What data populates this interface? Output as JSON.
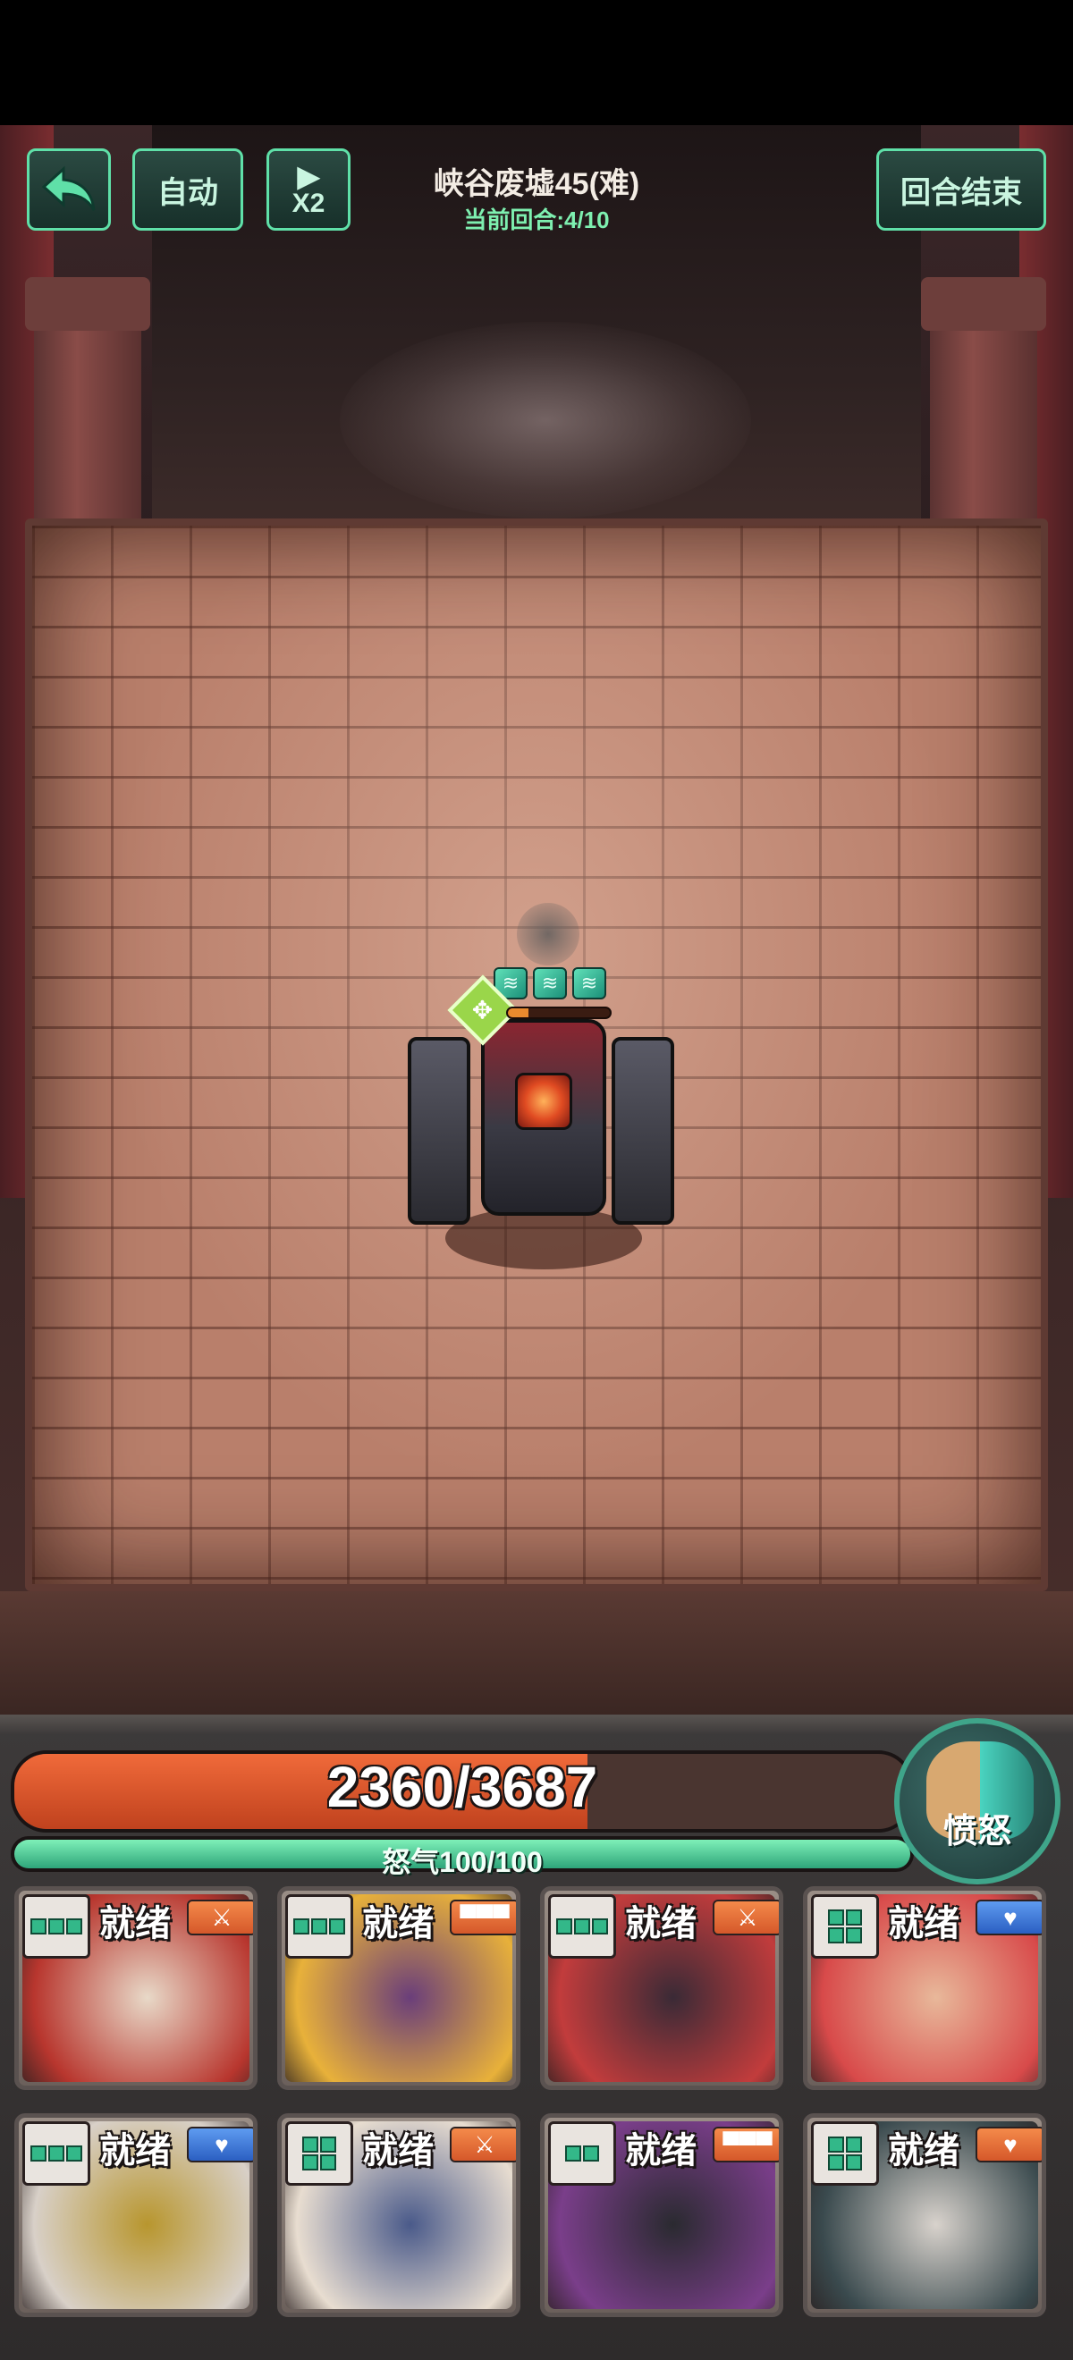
{
  "hud": {
    "back_icon": "back-arrow-icon",
    "auto_label": "自动",
    "speed_play_glyph": "▶",
    "speed_label": "X2",
    "end_turn_label": "回合结束",
    "stage_title": "峡谷废墟45(难)",
    "turn_info": "当前回合:4/10"
  },
  "enemy": {
    "name_icon": "mech-boss",
    "status_icons": [
      "wind-buff-icon",
      "wind-buff-icon",
      "wind-buff-icon"
    ],
    "status_glyph": "≋",
    "target_glyph": "✥",
    "hp_fraction": 0.2
  },
  "team": {
    "hp_text": "2360/3687",
    "hp_current": 2360,
    "hp_max": 3687,
    "rage_text": "怒气100/100",
    "rage_current": 100,
    "rage_max": 100,
    "fury_label": "愤怒"
  },
  "colors": {
    "accent_green": "#5fe0a8",
    "hp_orange": "#f06a3a",
    "rage_green": "#7ef0b8"
  },
  "heroes": [
    {
      "status": "就绪",
      "energy": 3,
      "class_icon": "sword-icon",
      "class_glyph": "⚔",
      "class_color": "orange",
      "portrait": [
        "#b8362e",
        "#e8d9c8"
      ]
    },
    {
      "status": "就绪",
      "energy": 3,
      "class_icon": "shield-row-icon",
      "class_glyph": "▀▀▀",
      "class_color": "orange",
      "portrait": [
        "#e8b13a",
        "#6a3e7a"
      ]
    },
    {
      "status": "就绪",
      "energy": 3,
      "class_icon": "sword-icon",
      "class_glyph": "⚔",
      "class_color": "orange",
      "portrait": [
        "#c23c3c",
        "#3a2a36"
      ]
    },
    {
      "status": "就绪",
      "energy": 4,
      "class_icon": "heart-icon",
      "class_glyph": "♥",
      "class_color": "blue",
      "portrait": [
        "#d84a4a",
        "#e8b89a"
      ]
    },
    {
      "status": "就绪",
      "energy": 3,
      "class_icon": "heart-icon",
      "class_glyph": "♥",
      "class_color": "blue",
      "portrait": [
        "#d8d0c8",
        "#b8962e"
      ]
    },
    {
      "status": "就绪",
      "energy": 4,
      "class_icon": "sword-icon",
      "class_glyph": "⚔",
      "class_color": "orange",
      "portrait": [
        "#e8ddd0",
        "#4a5a8a"
      ]
    },
    {
      "status": "就绪",
      "energy": 2,
      "class_icon": "shield-row-icon",
      "class_glyph": "▀▀▀",
      "class_color": "orange",
      "portrait": [
        "#7a3e8a",
        "#2a2a30"
      ]
    },
    {
      "status": "就绪",
      "energy": 4,
      "class_icon": "heart-icon",
      "class_glyph": "♥",
      "class_color": "orange",
      "portrait": [
        "#3a4a4e",
        "#d8d2cc"
      ]
    }
  ]
}
